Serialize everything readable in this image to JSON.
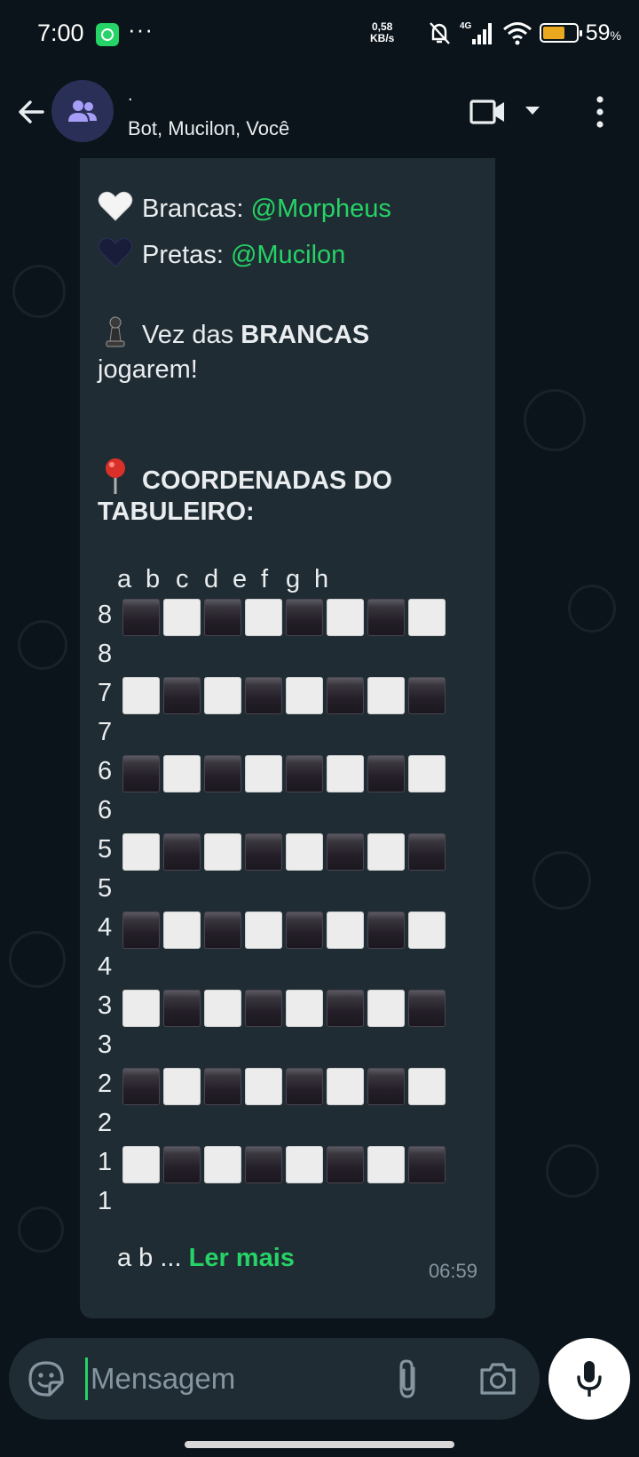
{
  "status_bar": {
    "time": "7:00",
    "dots": "···",
    "speed_value": "0,58",
    "speed_unit": "KB/s",
    "network": "4G",
    "battery_percent": "59",
    "battery_symbol": "%",
    "battery_level": 0.59
  },
  "header": {
    "title": ".",
    "subtitle": "Bot, Mucilon, Você"
  },
  "message": {
    "white_label": "Brancas: ",
    "white_player": "@Morpheus",
    "black_label": "Pretas: ",
    "black_player": "@Mucilon",
    "turn_prefix": "Vez das ",
    "turn_color": "BRANCAS",
    "turn_suffix": "jogarem!",
    "coords_title_1": "COORDENADAS DO",
    "coords_title_2": "TABULEIRO:",
    "columns": [
      "a",
      "b",
      "c",
      "d",
      "e",
      "f",
      "g",
      "h"
    ],
    "rows": [
      "8",
      "7",
      "6",
      "5",
      "4",
      "3",
      "2",
      "1"
    ],
    "tail_text": "a  b ... ",
    "read_more": "Ler mais",
    "time": "06:59"
  },
  "input": {
    "placeholder": "Mensagem"
  },
  "icons": {
    "back": "arrow-left-icon",
    "avatar": "group-icon",
    "video": "video-call-icon",
    "caret": "caret-down-icon",
    "menu": "more-vertical-icon",
    "emoji": "sticker-icon",
    "attach": "paperclip-icon",
    "camera": "camera-icon",
    "mic": "microphone-icon"
  },
  "colors": {
    "accent": "#25d366",
    "background": "#0b141a",
    "bubble": "#202c33"
  }
}
